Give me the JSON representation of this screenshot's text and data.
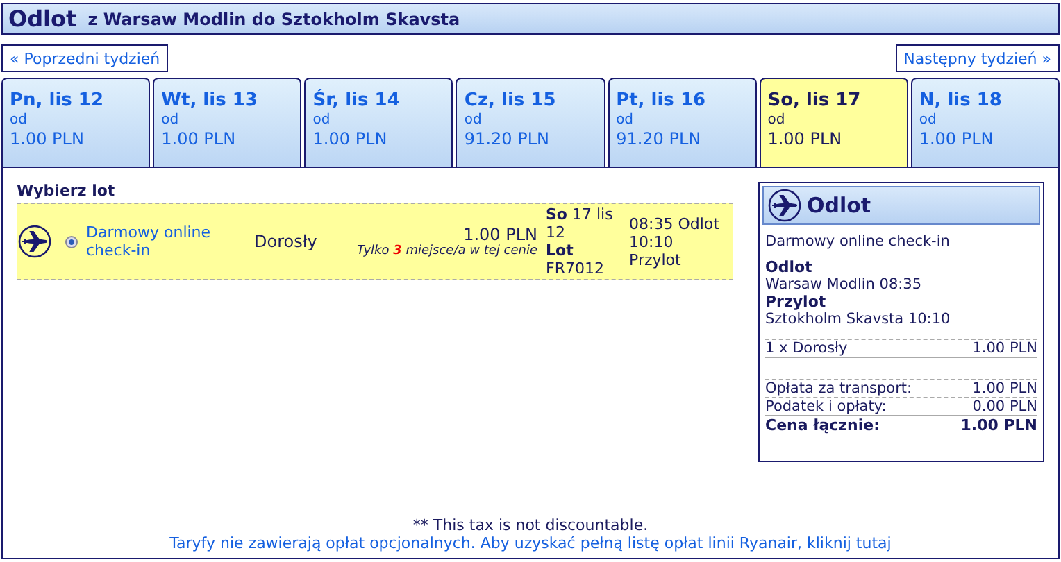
{
  "header": {
    "title": "Odlot",
    "route": "z Warsaw Modlin do Sztokholm Skavsta"
  },
  "nav": {
    "prev": "« Poprzedni tydzień",
    "next": "Następny tydzień »"
  },
  "days": [
    {
      "label": "Pn, lis 12",
      "from": "od",
      "price": "1.00 PLN",
      "selected": false
    },
    {
      "label": "Wt, lis 13",
      "from": "od",
      "price": "1.00 PLN",
      "selected": false
    },
    {
      "label": "Śr, lis 14",
      "from": "od",
      "price": "1.00 PLN",
      "selected": false
    },
    {
      "label": "Cz, lis 15",
      "from": "od",
      "price": "91.20 PLN",
      "selected": false
    },
    {
      "label": "Pt, lis 16",
      "from": "od",
      "price": "91.20 PLN",
      "selected": false
    },
    {
      "label": "So, lis 17",
      "from": "od",
      "price": "1.00 PLN",
      "selected": true
    },
    {
      "label": "N, lis 18",
      "from": "od",
      "price": "1.00 PLN",
      "selected": false
    }
  ],
  "flights": {
    "heading": "Wybierz lot",
    "rows": [
      {
        "fare": "Darmowy online check-in",
        "selected": true,
        "passenger": "Dorosły",
        "price": "1.00 PLN",
        "availability": "Tylko **3** miejsce/a w tej cenie",
        "date": "**So** 17 lis 12",
        "flight": "**Lot** FR7012",
        "departure": "08:35 Odlot",
        "arrival": "10:10 Przylot"
      }
    ]
  },
  "summary": {
    "title": "Odlot",
    "fare": "Darmowy online check-in",
    "departure_label": "Odlot",
    "departure": "Warsaw Modlin 08:35",
    "arrival_label": "Przylot",
    "arrival": "Sztokholm Skavsta 10:10",
    "lines": [
      {
        "label": "1 x Dorosły",
        "value": "1.00 PLN",
        "kind": "item"
      },
      {
        "label": "Opłata za transport:",
        "value": "1.00 PLN",
        "kind": "fee"
      },
      {
        "label": "Podatek i opłaty:",
        "value": "0.00 PLN",
        "kind": "fee"
      },
      {
        "label": "Cena łącznie:",
        "value": "1.00 PLN",
        "kind": "total"
      }
    ]
  },
  "footer": {
    "note": "** This tax is not discountable.",
    "link": "Taryfy nie zawierają opłat opcjonalnych. Aby uzyskać pełną listę opłat linii Ryanair, kliknij tutaj"
  }
}
